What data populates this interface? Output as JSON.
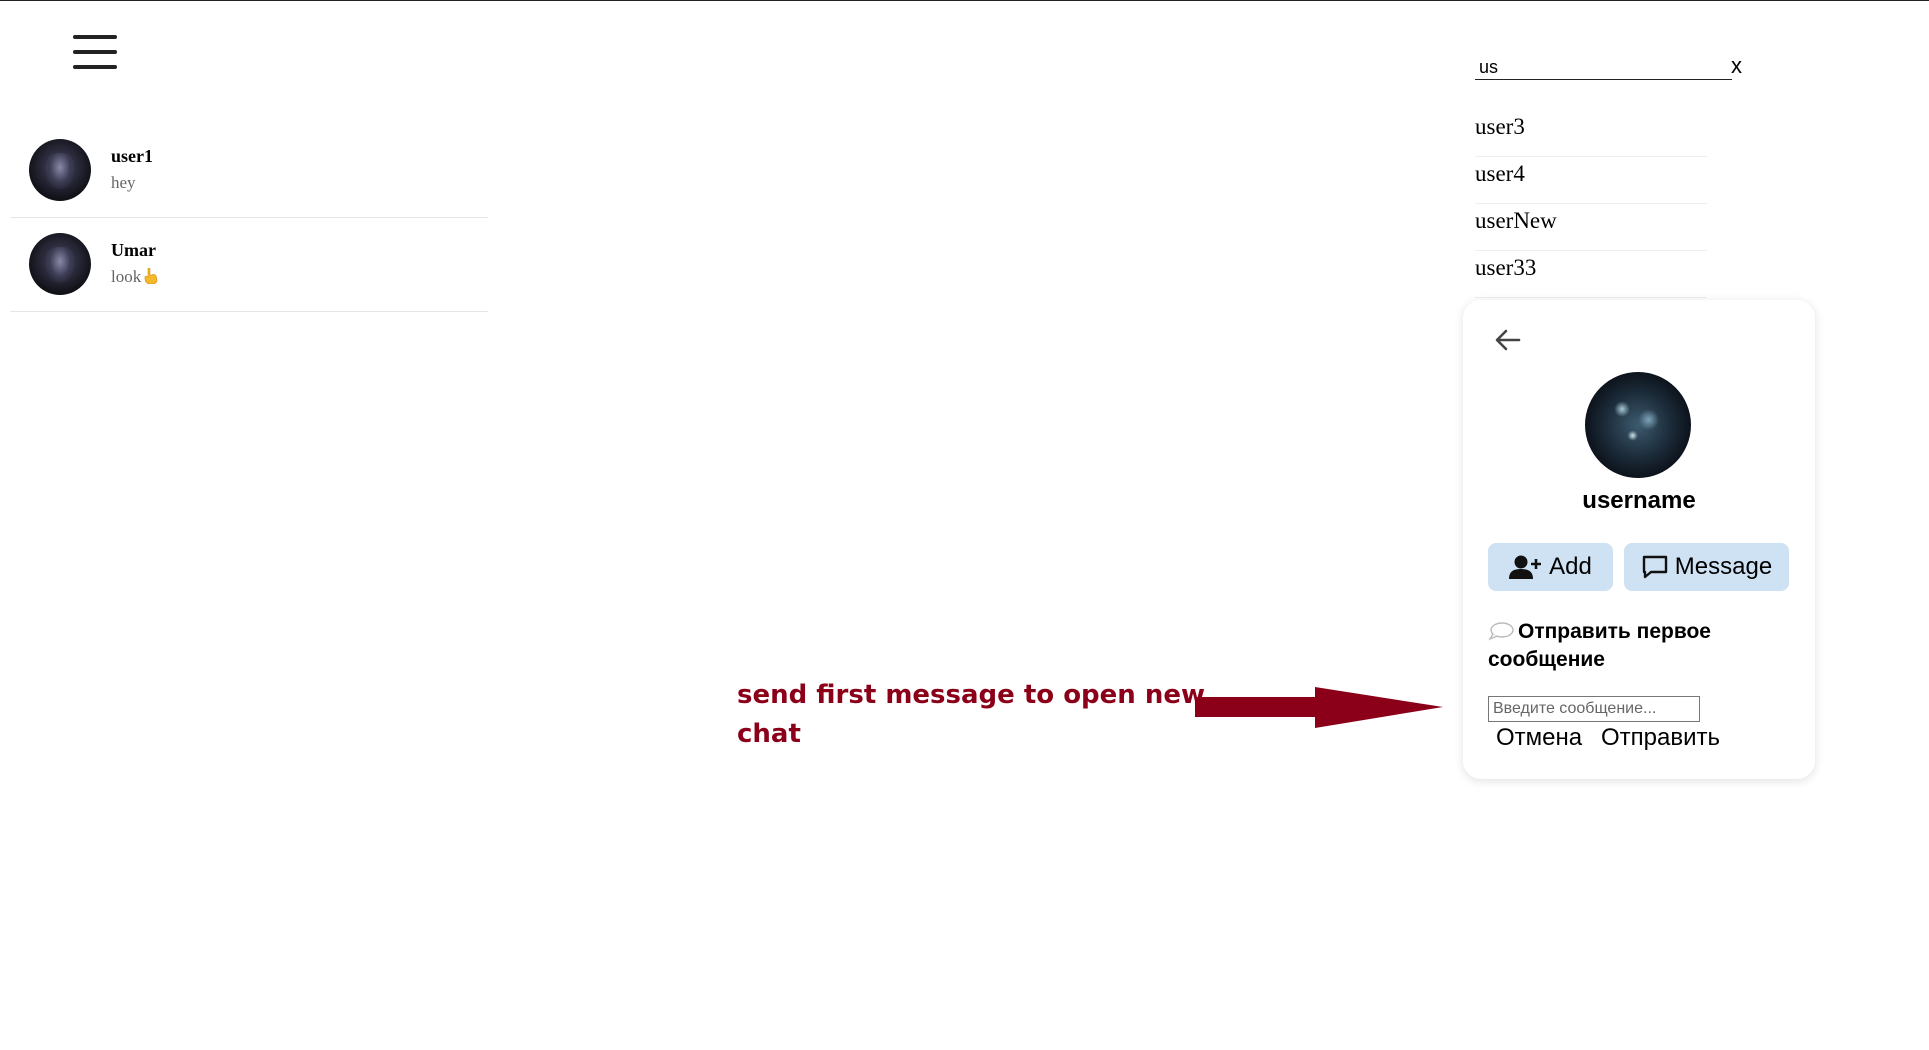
{
  "menu": {
    "icon": "hamburger-menu-icon"
  },
  "chats": [
    {
      "name": "user1",
      "preview": "hey",
      "emoji": ""
    },
    {
      "name": "Umar",
      "preview": "look",
      "emoji": "pointing-hand"
    }
  ],
  "search": {
    "value": "us",
    "close_label": "x",
    "results": [
      "user3",
      "user4",
      "userNew",
      "user33"
    ]
  },
  "profile": {
    "username": "username",
    "add_label": "Add",
    "message_label": "Message",
    "first_message_title": "Отправить первое сообщение",
    "input_placeholder": "Введите сообщение...",
    "cancel_label": "Отмена",
    "send_label": "Отправить"
  },
  "annotation": {
    "text": "send first message to open new chat",
    "color": "#8b0018"
  },
  "colors": {
    "button_bg": "#cfe2f3",
    "annotation": "#8b0018"
  }
}
